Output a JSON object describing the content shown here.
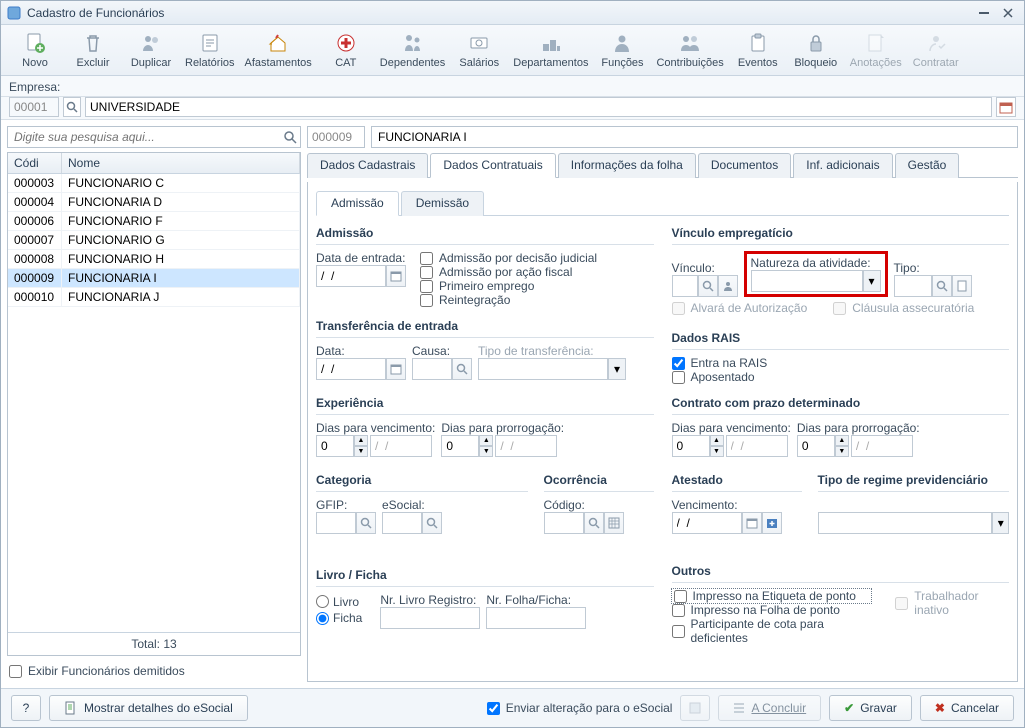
{
  "window": {
    "title": "Cadastro de Funcionários"
  },
  "toolbar": {
    "novo": "Novo",
    "excluir": "Excluir",
    "duplicar": "Duplicar",
    "relatorios": "Relatórios",
    "afastamentos": "Afastamentos",
    "cat": "CAT",
    "dependentes": "Dependentes",
    "salarios": "Salários",
    "departamentos": "Departamentos",
    "funcoes": "Funções",
    "contribuicoes": "Contribuições",
    "eventos": "Eventos",
    "bloqueio": "Bloqueio",
    "anotacoes": "Anotações",
    "contratar": "Contratar"
  },
  "empresa": {
    "label": "Empresa:",
    "code": "00001",
    "name": "UNIVERSIDADE"
  },
  "search": {
    "placeholder": "Digite sua pesquisa aqui..."
  },
  "grid": {
    "col_codi": "Códi",
    "col_nome": "Nome",
    "rows": [
      {
        "cod": "000003",
        "nome": "FUNCIONARIO C"
      },
      {
        "cod": "000004",
        "nome": "FUNCIONARIA D"
      },
      {
        "cod": "000006",
        "nome": "FUNCIONARIO F"
      },
      {
        "cod": "000007",
        "nome": "FUNCIONARIO G"
      },
      {
        "cod": "000008",
        "nome": "FUNCIONARIO H"
      },
      {
        "cod": "000009",
        "nome": "FUNCIONARIA I"
      },
      {
        "cod": "000010",
        "nome": "FUNCIONARIA J"
      }
    ],
    "selected": "000009",
    "total": "Total: 13",
    "show_dismissed": "Exibir Funcionários demitidos"
  },
  "header": {
    "code": "000009",
    "name": "FUNCIONARIA I"
  },
  "tabs": [
    "Dados Cadastrais",
    "Dados Contratuais",
    "Informações da folha",
    "Documentos",
    "Inf. adicionais",
    "Gestão"
  ],
  "subtabs": [
    "Admissão",
    "Demissão"
  ],
  "admissao": {
    "legend": "Admissão",
    "data_entrada": "Data de entrada:",
    "date_val": "/  /",
    "chk_judicial": "Admissão por decisão judicial",
    "chk_fiscal": "Admissão por ação fiscal",
    "chk_primeiro": "Primeiro emprego",
    "chk_reint": "Reintegração"
  },
  "vinculo": {
    "legend": "Vínculo empregatício",
    "vinculo": "Vínculo:",
    "natureza": "Natureza da atividade:",
    "tipo": "Tipo:",
    "alvara": "Alvará de Autorização",
    "clausula": "Cláusula assecuratória"
  },
  "transferencia": {
    "legend": "Transferência de entrada",
    "data": "Data:",
    "date_val": "/  /",
    "causa": "Causa:",
    "tipo": "Tipo de transferência:"
  },
  "rais": {
    "legend": "Dados RAIS",
    "entra": "Entra na RAIS",
    "aposentado": "Aposentado"
  },
  "experiencia": {
    "legend": "Experiência",
    "dias_venc": "Dias para vencimento:",
    "dias_prorr": "Dias para prorrogação:",
    "val0": "0",
    "date_ph": "/  /"
  },
  "contrato_prazo": {
    "legend": "Contrato com prazo determinado",
    "dias_venc": "Dias para vencimento:",
    "dias_prorr": "Dias para prorrogação:",
    "val0": "0",
    "date_ph": "/  /"
  },
  "categoria": {
    "legend": "Categoria",
    "gfip": "GFIP:",
    "esocial": "eSocial:"
  },
  "ocorrencia": {
    "legend": "Ocorrência",
    "codigo": "Código:"
  },
  "atestado": {
    "legend": "Atestado",
    "vencimento": "Vencimento:",
    "date_val": "/  /"
  },
  "regime": {
    "legend": "Tipo de regime previdenciário"
  },
  "livro": {
    "legend": "Livro / Ficha",
    "livro": "Livro",
    "ficha": "Ficha",
    "nr_livro": "Nr. Livro Registro:",
    "nr_folha": "Nr. Folha/Ficha:"
  },
  "outros": {
    "legend": "Outros",
    "etiq": "Impresso na Etiqueta de ponto",
    "folha": "Impresso na Folha de ponto",
    "cota": "Participante de cota para deficientes",
    "inativo": "Trabalhador inativo"
  },
  "footer": {
    "help": "?",
    "esocial": "Mostrar detalhes do eSocial",
    "enviar": "Enviar alteração para o eSocial",
    "concluir": "A Concluir",
    "gravar": "Gravar",
    "cancelar": "Cancelar"
  }
}
